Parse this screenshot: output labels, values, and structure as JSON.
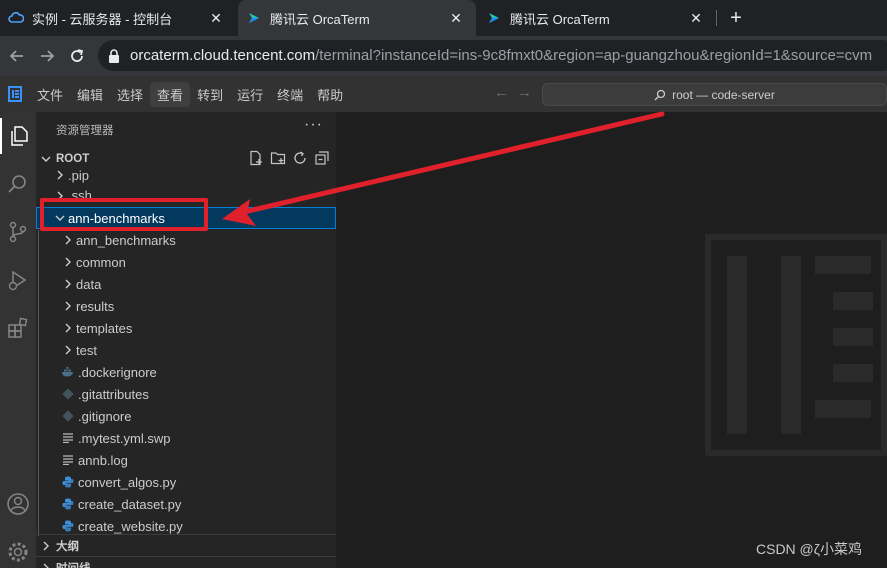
{
  "browser": {
    "tabs": [
      {
        "title": "实例 - 云服务器 - 控制台",
        "active": false
      },
      {
        "title": "腾讯云 OrcaTerm",
        "active": true
      },
      {
        "title": "腾讯云 OrcaTerm",
        "active": false
      }
    ],
    "new_tab_label": "+",
    "close_glyph": "✕",
    "url_host": "orcaterm.cloud.tencent.com",
    "url_path": "/terminal?instanceId=ins-9c8fmxt0&region=ap-guangzhou&regionId=1&source=cvm"
  },
  "menubar": {
    "items": [
      "文件",
      "编辑",
      "选择",
      "查看",
      "转到",
      "运行",
      "终端",
      "帮助"
    ],
    "command_center": "root — code-server"
  },
  "explorer": {
    "title": "资源管理器",
    "more": "···",
    "root_label": "ROOT",
    "items": [
      {
        "label": ".pip",
        "type": "folder",
        "level": 1
      },
      {
        "label": ".ssh",
        "type": "folder",
        "level": 1
      },
      {
        "label": "ann-benchmarks",
        "type": "folder-open",
        "level": 1,
        "selected": true
      },
      {
        "label": "ann_benchmarks",
        "type": "folder",
        "level": 2
      },
      {
        "label": "common",
        "type": "folder",
        "level": 2
      },
      {
        "label": "data",
        "type": "folder",
        "level": 2
      },
      {
        "label": "results",
        "type": "folder",
        "level": 2
      },
      {
        "label": "templates",
        "type": "folder",
        "level": 2
      },
      {
        "label": "test",
        "type": "folder",
        "level": 2
      },
      {
        "label": ".dockerignore",
        "type": "docker",
        "level": 2
      },
      {
        "label": ".gitattributes",
        "type": "git",
        "level": 2
      },
      {
        "label": ".gitignore",
        "type": "git",
        "level": 2
      },
      {
        "label": ".mytest.yml.swp",
        "type": "text",
        "level": 2
      },
      {
        "label": "annb.log",
        "type": "text",
        "level": 2
      },
      {
        "label": "convert_algos.py",
        "type": "python",
        "level": 2
      },
      {
        "label": "create_dataset.py",
        "type": "python",
        "level": 2
      },
      {
        "label": "create_website.py",
        "type": "python",
        "level": 2
      }
    ],
    "outline_label": "大纲",
    "timeline_label": "时间线"
  },
  "watermark": "CSDN @ζ小菜鸡",
  "colors": {
    "selection": "#04395e",
    "annotation_red": "#e0202a",
    "python_icon": "#3b8fd9"
  }
}
